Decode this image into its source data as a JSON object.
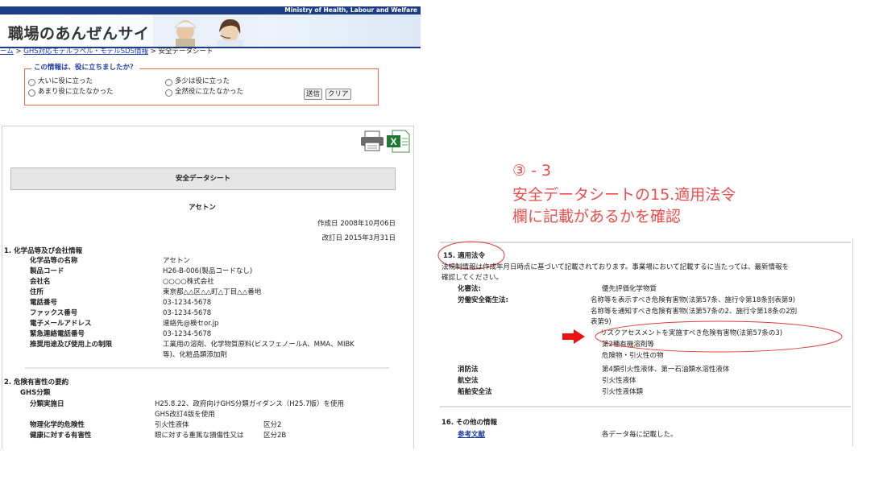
{
  "header": {
    "ministry": "Ministry of Health, Labour and Welfare",
    "site_title": "職場のあんぜんサイト"
  },
  "breadcrumb": {
    "home": "ーム",
    "sep": ">",
    "ghs_link": "GHS対応モデルラベル・モデルSDS情報",
    "current": "安全データシート"
  },
  "feedback": {
    "question": "この情報は、役に立ちましたか？",
    "options": [
      "大いに役に立った",
      "多少は役に立った",
      "あまり役に立たなかった",
      "全然役に立たなかった"
    ],
    "send": "送信",
    "clear": "クリア"
  },
  "sds": {
    "title": "安全データシート",
    "product": "アセトン",
    "created": "作成日 2008年10月06日",
    "revised": "改訂日 2015年3月31日",
    "section1": {
      "heading": "1. 化学品等及び会社情報",
      "rows": [
        {
          "label": "化学品等の名称",
          "value": "アセトン"
        },
        {
          "label": "製品コード",
          "value": "H26-B-006(製品コードなし)"
        },
        {
          "label": "会社名",
          "value": "○○○○株式会社"
        },
        {
          "label": "住所",
          "value": "東京都△△区△△町△丁目△△番地"
        },
        {
          "label": "電話番号",
          "value": "03-1234-5678"
        },
        {
          "label": "ファックス番号",
          "value": "03-1234-5678"
        },
        {
          "label": "電子メールアドレス",
          "value": "連絡先@検セor.jp"
        },
        {
          "label": "緊急連絡電話番号",
          "value": "03-1234-5678"
        },
        {
          "label": "推奨用途及び使用上の制限",
          "value": "工業用の溶剤、化学物質原料(ビスフェノールA、MMA、MIBK"
        }
      ],
      "use_cont": "等)、化粧品類添加剤"
    },
    "section2": {
      "heading": "2. 危険有害性の要約",
      "ghs": "GHS分類",
      "basis_label": "分類実施日",
      "basis_value": "H25.8.22、政府向けGHS分類ガイダンス（H25.7版）を使用",
      "basis_value2": "GHS改訂4版を使用",
      "phys_label": "物理化学的危険性",
      "phys_value": "引火性液体",
      "phys_class": "区分2",
      "health_label": "健康に対する有害性",
      "health_value": "眼に対する重篤な損傷性又は",
      "health_class": "区分2B"
    }
  },
  "annotation": {
    "line1": "③ - 3",
    "line2": "安全データシートの15.適用法令",
    "line3": "欄に記載があるかを確認"
  },
  "zoom": {
    "heading": "15. 適用法令",
    "intro1": "法規制情報は作成年月日時点に基づいて記載されております。事業場において記載するに当たっては、最新情報を",
    "intro2": "確認してください。",
    "chem_label": "化審法:",
    "chem_value": "優先評価化学物質",
    "labor_label": "労働安全衛生法:",
    "labor_values": [
      "名称等を表示すべき危険有害物(法第57条、施行令第18条別表第9)",
      "名称等を通知すべき危険有害物(法第57条の2、施行令第18条の2別",
      "表第9)",
      "リスクアセスメントを実施すべき危険有害物(法第57条の3)",
      "第2種有機溶剤等",
      "危険物・引火性の物"
    ],
    "fire_label": "消防法",
    "fire_value": "第4類引火性液体、第一石油類水溶性液体",
    "air_label": "航空法",
    "air_value": "引火性液体",
    "ship_label": "船舶安全法",
    "ship_value": "引火性液体類",
    "other_heading": "16. その他の情報",
    "ref_label": "参考文献",
    "ref_value": "各データ毎に記載した。"
  }
}
